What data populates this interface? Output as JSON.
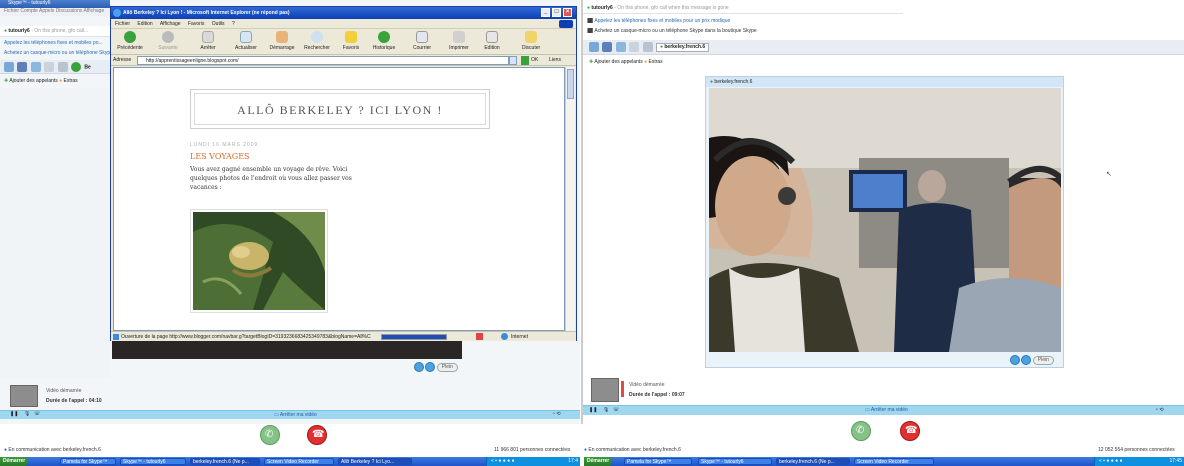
{
  "left_skype": {
    "title": "Skype™ - tutourly6",
    "menu": "Fichier  Compte  Appels  Discussions  Affichage",
    "status_name": "tutourly6",
    "mood": "- On this phone, gfo call...",
    "promo1": "Appelez les téléphones fixes et mobiles po...",
    "promo2": "Achetez un casque-micro ou un téléphone Skype",
    "contact_tab": "Be",
    "add_callers": "Ajouter des appelants",
    "extras": "Extras",
    "video_status": "Vidéo démarrée",
    "call_duration": "Durée de l'appel : 04:10",
    "stop_video": "Arrêter ma vidéo",
    "more": "Plein"
  },
  "ie": {
    "title": "Allô Berkeley ? Ici Lyon ! - Microsoft Internet Explorer (ne répond pas)",
    "menu": [
      "Fichier",
      "Edition",
      "Affichage",
      "Favoris",
      "Outils",
      "?"
    ],
    "toolbar": [
      "Précédente",
      "Suivante",
      "Arrêter",
      "Actualiser",
      "Démarrage",
      "Rechercher",
      "Favoris",
      "Historique",
      "Courrier",
      "Imprimer",
      "Edition",
      "Discuter"
    ],
    "address_label": "Adresse",
    "address_value": "http://apprentissageenligne.blogspot.com/",
    "go_label": "OK",
    "links_label": "Liens",
    "status_text": "Ouverture de la page http://www.blogger.com/navbar.g?targetBlogID=3193236683425349783&blogName=All%C3%B4+Berk",
    "zone": "Internet"
  },
  "blog": {
    "title": "ALLÔ BERKELEY ? ICI LYON !",
    "date": "LUNDI 16 MARS 2009",
    "post_title": "LES VOYAGES",
    "post_body": [
      "Vous avez gagné ensemble un voyage de rêve. Voici",
      "quelques photos de l'endroit où vous allez passer vos",
      "vacances :"
    ]
  },
  "right_skype": {
    "mood": "- On this phone, gfo call when this message is gone",
    "status_name": "tutourly6",
    "promo1": "Appelez les téléphones fixes et mobiles pour un prix modique",
    "promo2": "Achetez un casque-micro ou un téléphone Skype dans la boutique Skype",
    "contact_tab": "berkeley.french.6",
    "add_callers": "Ajouter des appelants",
    "extras": "Extras",
    "video_title": "berkeley.french.6",
    "video_status": "Vidéo démarrée",
    "call_duration": "Durée de l'appel : 09:07",
    "stop_video": "Arrêter ma vidéo",
    "more": "Plein"
  },
  "left_footer": {
    "status": "En communication avec berkeley.french.6",
    "online_count": "11 966 801 personnes connectées"
  },
  "right_footer": {
    "status": "En communication avec berkeley.french.6",
    "online_count": "12 052 554 personnes connectées"
  },
  "taskbar_left": {
    "start": "Démarrer",
    "buttons": [
      "Pamela for Skype™",
      "Skype™ - tutourly6",
      "berkeley.french.6 (Ne p...",
      "Screen Video Recorder",
      "Allô Berkeley ? Ici Lyo..."
    ],
    "clock": "17:4"
  },
  "taskbar_right": {
    "start": "Démarrer",
    "buttons": [
      "Pamela for Skype™",
      "Skype™ - tutourly6",
      "berkeley.french.6 (Ne p...",
      "Screen Video Recorder"
    ],
    "clock": "17:45"
  },
  "colors": {
    "ie_title": "#0b3fb3",
    "skype_blue": "#9fd6f0",
    "call_green": "#7fbf7f",
    "hangup_red": "#e02a2a",
    "blog_accent": "#d86a2a"
  }
}
